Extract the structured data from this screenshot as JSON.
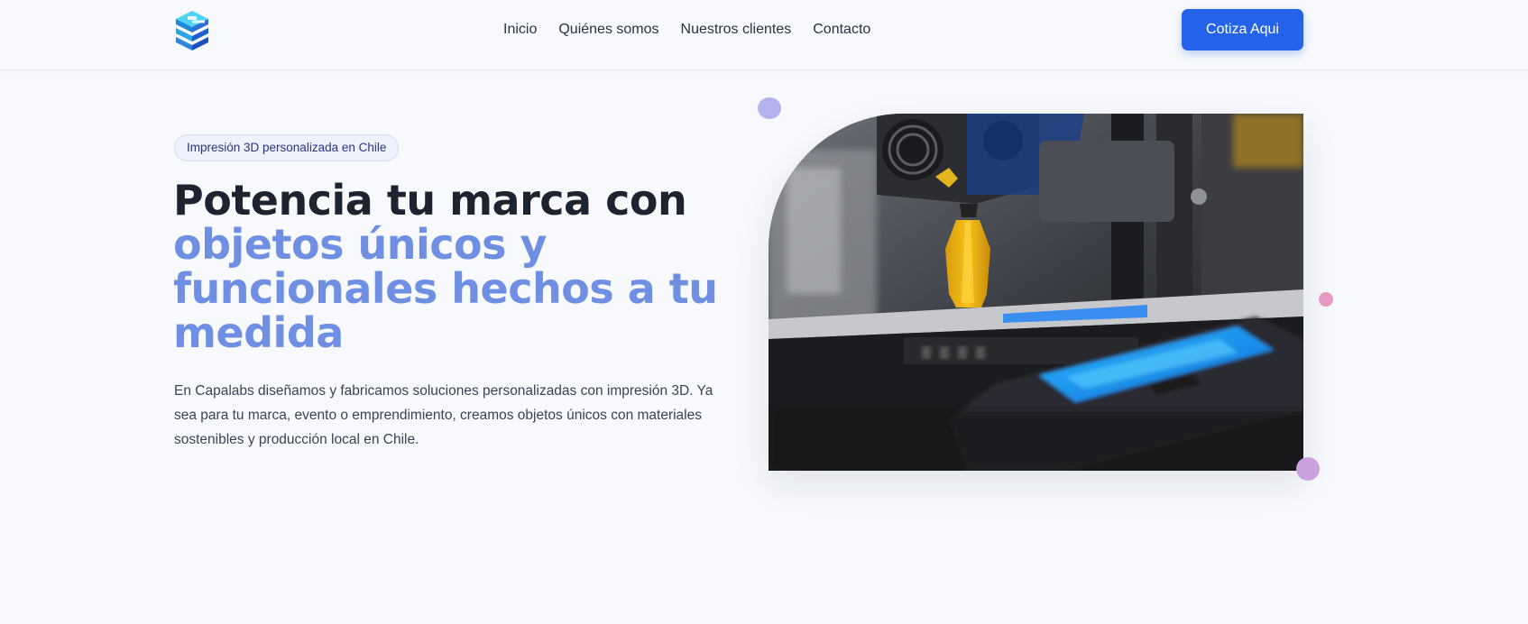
{
  "nav": {
    "links": [
      "Inicio",
      "Quiénes somos",
      "Nuestros clientes",
      "Contacto"
    ],
    "cta_label": "Cotiza Aqui"
  },
  "hero": {
    "badge": "Impresión 3D personalizada en Chile",
    "headline_dark": "Potencia tu marca con",
    "headline_accent": "objetos únicos y funcionales hechos a tu medida",
    "description": "En Capalabs diseñamos y fabricamos soluciones personalizadas con impresión 3D. Ya sea para tu marca, evento o emprendimiento, creamos objetos únicos con materiales sostenibles y producción local en Chile."
  },
  "icons": {
    "logo": "cube-logo-icon"
  },
  "colors": {
    "accent": "#2563eb",
    "headline_accent": "#6f8fe3",
    "headline_dark": "#1e2330",
    "background": "#f7f9fc"
  }
}
